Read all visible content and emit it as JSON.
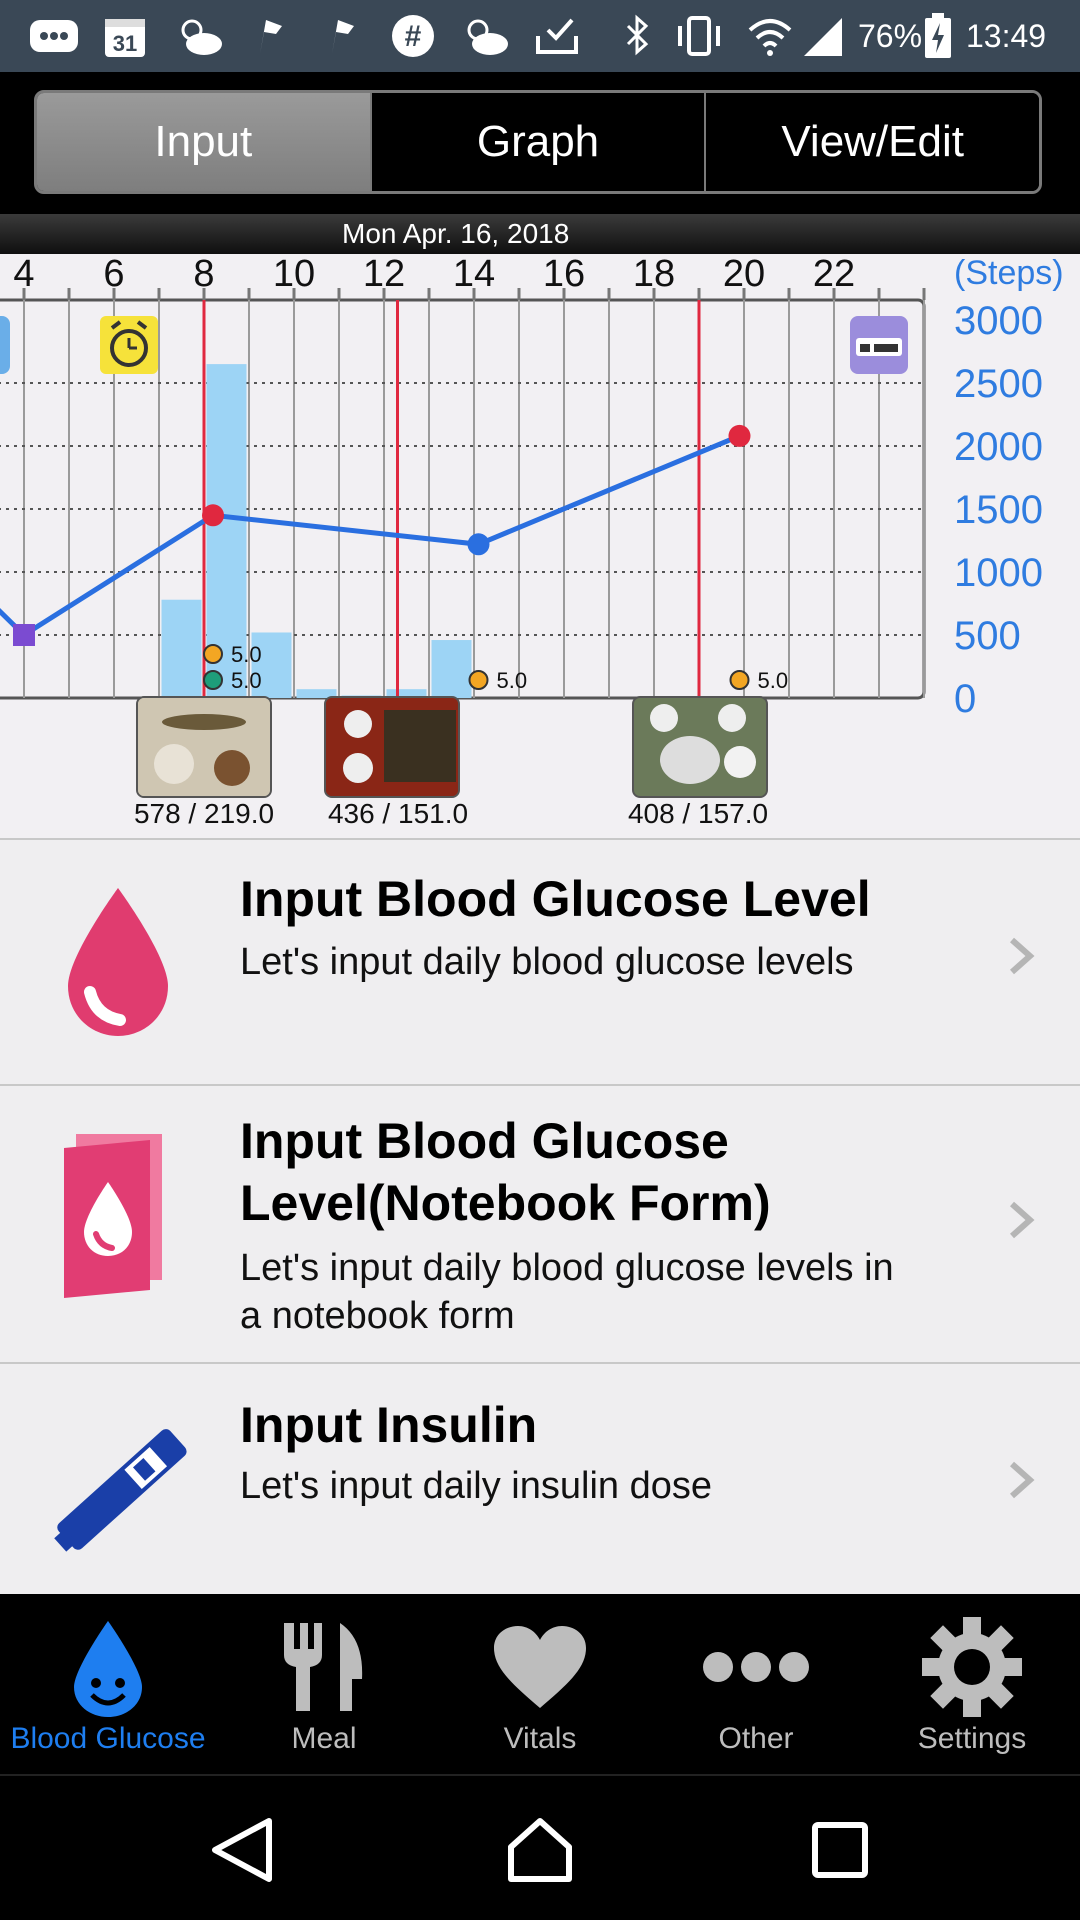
{
  "status_bar": {
    "calendar_day": "31",
    "battery_percent": "76%",
    "time": "13:49",
    "icons": [
      "messages-icon",
      "calendar-icon",
      "weather-icon",
      "flag-icon",
      "flag-icon",
      "hashtag-icon",
      "weather-icon",
      "inbox-icon",
      "bluetooth-icon",
      "vibrate-icon",
      "wifi-icon",
      "signal-icon",
      "battery-charging-icon"
    ]
  },
  "tabs": [
    {
      "label": "Input",
      "active": true
    },
    {
      "label": "Graph",
      "active": false
    },
    {
      "label": "View/Edit",
      "active": false
    }
  ],
  "chart": {
    "date": "Mon Apr. 16, 2018",
    "x_ticks": [
      "4",
      "6",
      "8",
      "10",
      "12",
      "14",
      "16",
      "18",
      "20",
      "22"
    ],
    "y_unit": "(Steps)",
    "y_ticks": [
      "3000",
      "2500",
      "2000",
      "1500",
      "1000",
      "500",
      "0"
    ],
    "marker_values": [
      "5.0",
      "5.0",
      "5.0",
      "5.0"
    ]
  },
  "chart_data": {
    "type": "bar",
    "x_ticks": [
      4,
      6,
      8,
      10,
      12,
      14,
      16,
      18,
      20,
      22
    ],
    "ylabel": "(Steps)",
    "ylim": [
      0,
      3000
    ],
    "steps_bars": [
      {
        "hour": 7.5,
        "value": 780
      },
      {
        "hour": 8.5,
        "value": 2650
      },
      {
        "hour": 9.5,
        "value": 520
      },
      {
        "hour": 10.5,
        "value": 70
      },
      {
        "hour": 11.5,
        "value": 20
      },
      {
        "hour": 12.5,
        "value": 70
      },
      {
        "hour": 13.5,
        "value": 460
      }
    ],
    "glucose_line": [
      {
        "hour": 4,
        "value": 500,
        "color": "#7b4bd1"
      },
      {
        "hour": 8.2,
        "value": 1450,
        "color": "#e0283f"
      },
      {
        "hour": 14.1,
        "value": 1220,
        "color": "#2a6fe0"
      },
      {
        "hour": 19.9,
        "value": 2080,
        "color": "#e0283f"
      }
    ],
    "meal_markers": [
      8,
      12.3,
      19
    ]
  },
  "meals": [
    {
      "label": "578 / 219.0"
    },
    {
      "label": "436 / 151.0"
    },
    {
      "label": "408 / 157.0"
    }
  ],
  "menu": [
    {
      "title": "Input Blood Glucose Level",
      "subtitle": "Let's input daily blood glucose levels",
      "icon": "blood-drop-icon"
    },
    {
      "title_line1": "Input Blood Glucose",
      "title_line2": "Level(Notebook Form)",
      "subtitle_line1": "Let's input daily blood glucose levels in",
      "subtitle_line2": "a notebook form",
      "icon": "notebook-drop-icon"
    },
    {
      "title": "Input Insulin",
      "subtitle": "Let's input daily insulin dose",
      "icon": "insulin-pen-icon"
    }
  ],
  "bottom_nav": [
    {
      "label": "Blood Glucose",
      "active": true
    },
    {
      "label": "Meal",
      "active": false
    },
    {
      "label": "Vitals",
      "active": false
    },
    {
      "label": "Other",
      "active": false
    },
    {
      "label": "Settings",
      "active": false
    }
  ],
  "colors": {
    "accent_blue": "#1e7ef0",
    "glucose_red": "#e0283f",
    "bar_blue": "#9dd4f5",
    "axis_blue": "#2f7ce0",
    "pink": "#e8336f"
  }
}
